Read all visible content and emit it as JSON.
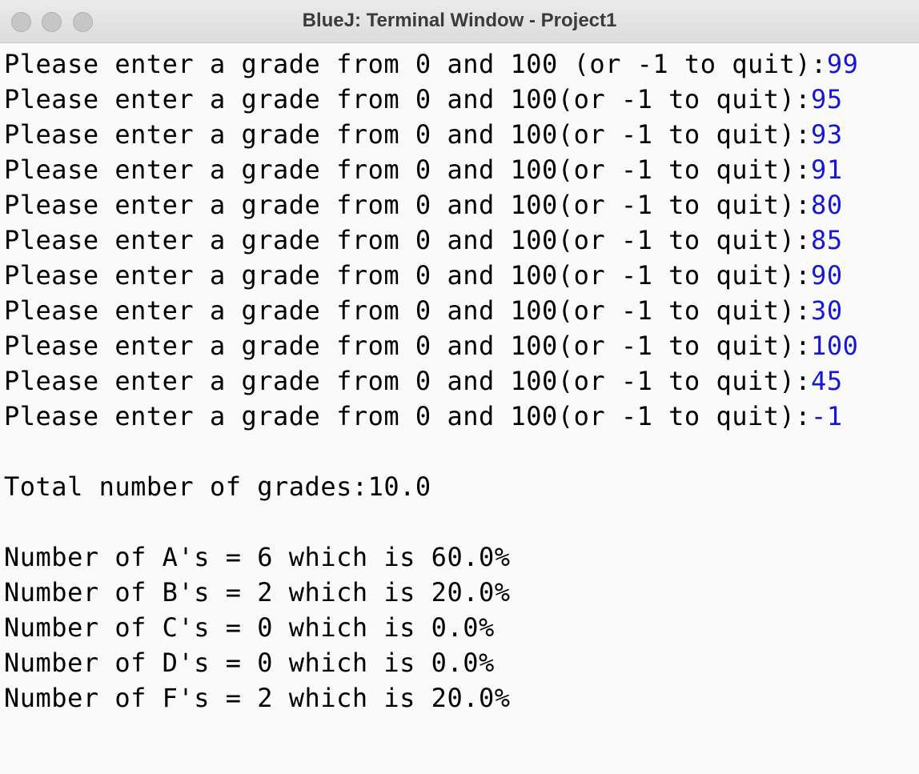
{
  "window": {
    "title": "BlueJ: Terminal Window - Project1"
  },
  "colors": {
    "input_text": "#1616d6",
    "output_text": "#000000",
    "background": "#fafafa"
  },
  "terminal": {
    "prompts": [
      {
        "prompt": "Please enter a grade from 0 and 100 (or -1 to quit):",
        "input": "99"
      },
      {
        "prompt": "Please enter a grade from 0 and 100(or -1 to quit):",
        "input": "95"
      },
      {
        "prompt": "Please enter a grade from 0 and 100(or -1 to quit):",
        "input": "93"
      },
      {
        "prompt": "Please enter a grade from 0 and 100(or -1 to quit):",
        "input": "91"
      },
      {
        "prompt": "Please enter a grade from 0 and 100(or -1 to quit):",
        "input": "80"
      },
      {
        "prompt": "Please enter a grade from 0 and 100(or -1 to quit):",
        "input": "85"
      },
      {
        "prompt": "Please enter a grade from 0 and 100(or -1 to quit):",
        "input": "90"
      },
      {
        "prompt": "Please enter a grade from 0 and 100(or -1 to quit):",
        "input": "30"
      },
      {
        "prompt": "Please enter a grade from 0 and 100(or -1 to quit):",
        "input": "100"
      },
      {
        "prompt": "Please enter a grade from 0 and 100(or -1 to quit):",
        "input": "45"
      },
      {
        "prompt": "Please enter a grade from 0 and 100(or -1 to quit):",
        "input": "-1"
      }
    ],
    "total_line": "Total number of grades:10.0",
    "summary": [
      "Number of A's = 6 which is 60.0%",
      "Number of B's = 2 which is 20.0%",
      "Number of C's = 0 which is 0.0%",
      "Number of D's = 0 which is 0.0%",
      "Number of F's = 2 which is 20.0%"
    ]
  }
}
